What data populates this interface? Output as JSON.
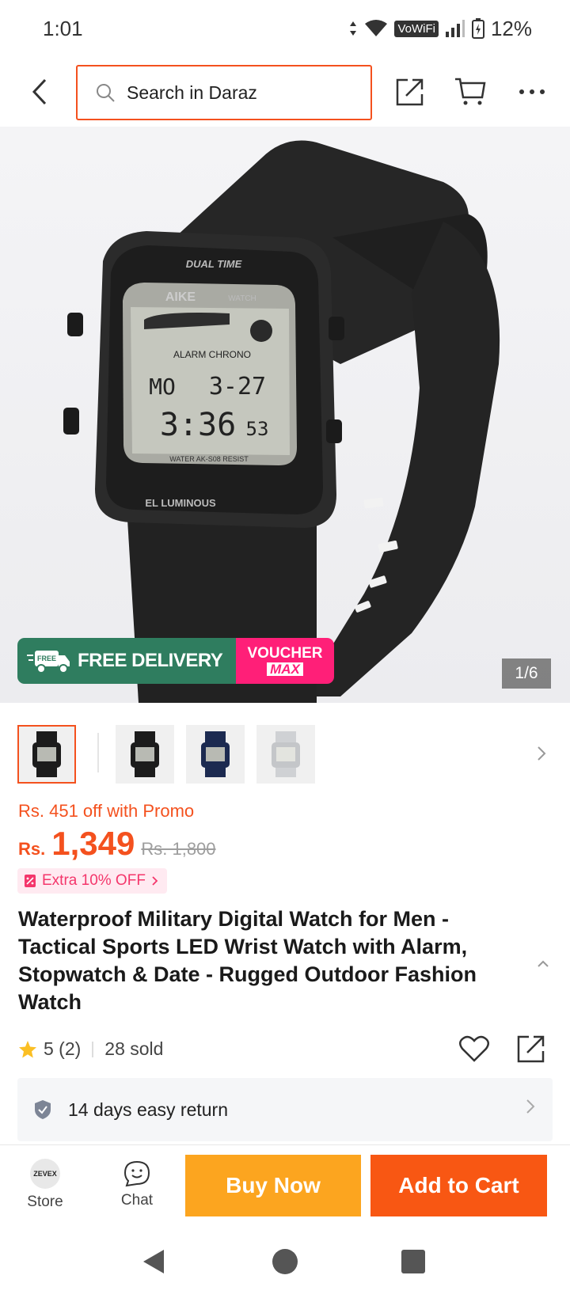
{
  "status_bar": {
    "time": "1:01",
    "network_label": "VoWiFi",
    "battery": "12%"
  },
  "header": {
    "search_placeholder": "Search in Daraz",
    "icons": [
      "back-arrow-icon",
      "search-icon",
      "share-icon",
      "cart-icon",
      "more-icon"
    ]
  },
  "gallery": {
    "badge_free_label": "FREE",
    "badge_delivery_label": "FREE DELIVERY",
    "badge_voucher_label": "VOUCHER",
    "badge_voucher_sub": "MAX",
    "counter": "1/6",
    "watch_texts": {
      "bezel_top": "DUAL TIME",
      "brand": "AIKE",
      "watch_word": "WATCH",
      "mode": "ALARM CHRONO",
      "day": "MO",
      "date": "3-27",
      "time": "3:36",
      "seconds": "53",
      "bottom_line": "WATER AK-S08 RESIST",
      "bezel_bottom": "EL LUMINOUS"
    },
    "thumbnail_colors": [
      "#1c1c1c",
      "#1c1c1c",
      "#1c2a50",
      "#cfd1d4"
    ]
  },
  "price": {
    "promo_text": "Rs. 451 off with Promo",
    "currency": "Rs.",
    "current": "1,349",
    "original": "Rs. 1,800",
    "extra_off": "Extra 10% OFF"
  },
  "product": {
    "title": "Waterproof Military Digital Watch for Men - Tactical Sports LED Wrist Watch with Alarm, Stopwatch & Date - Rugged Outdoor Fashion Watch",
    "rating": "5 (2)",
    "sold": "28 sold",
    "return_policy": "14 days easy return"
  },
  "bottom_bar": {
    "store_logo_text": "ZEVEX",
    "store_label": "Store",
    "chat_label": "Chat",
    "buy_now": "Buy Now",
    "add_to_cart": "Add to Cart"
  },
  "colors": {
    "accent": "#f85713",
    "price": "#f4511e",
    "buy_now": "#fca51f",
    "delivery_green": "#2f7d5f",
    "voucher_pink": "#ff1f78"
  }
}
